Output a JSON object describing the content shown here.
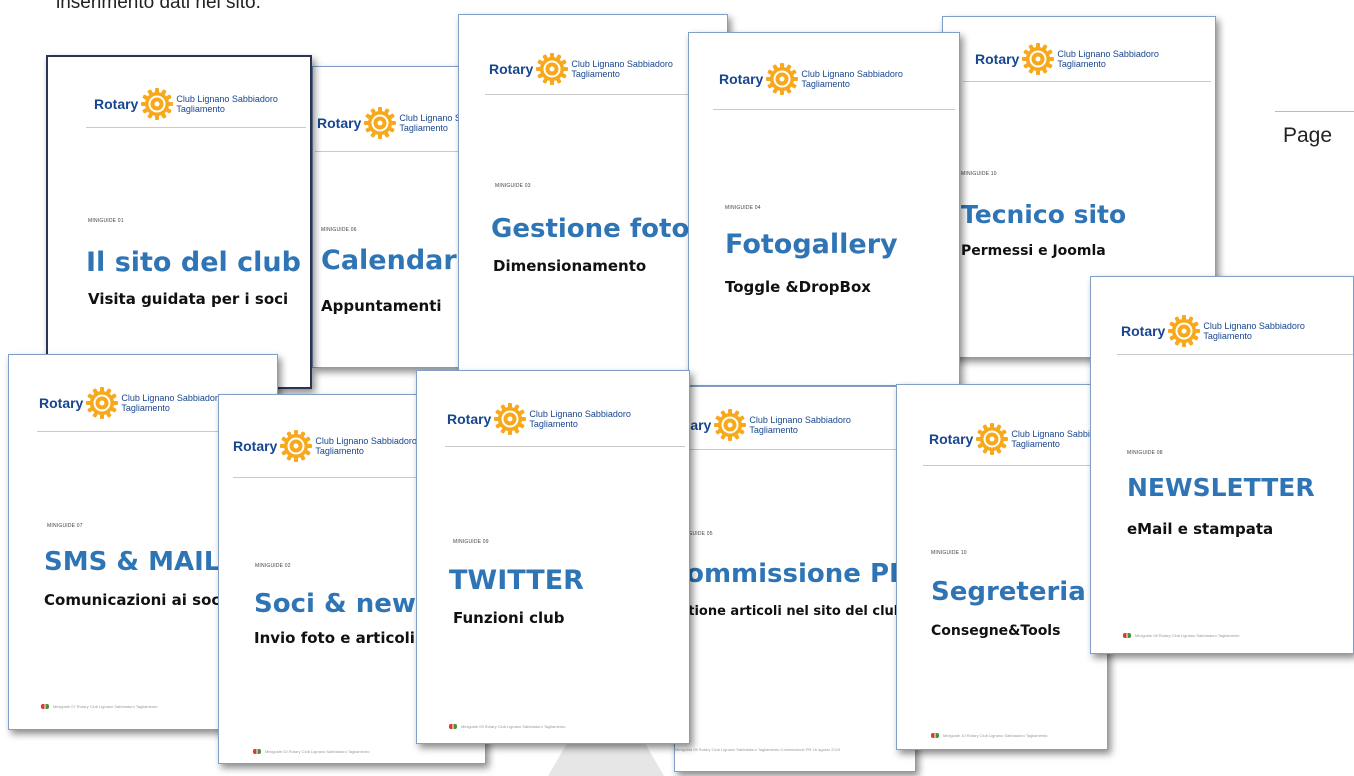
{
  "header_text": "inserimento dati nel sito.",
  "page_label": "Page",
  "brand": {
    "rotary": "Rotary",
    "club_line1": "Club Lignano Sabbiadoro",
    "club_line2": "Tagliamento",
    "blue": "#17458f",
    "gold": "#f7a81b",
    "title_blue": "#2f75b5"
  },
  "cards": [
    {
      "id": "calendar",
      "mini": "MINIGUIDE 06",
      "title": "Calendar",
      "subtitle": "Appuntamenti",
      "footer": ""
    },
    {
      "id": "sito-club",
      "mini": "MINIGUIDE 01",
      "title": "Il sito del club",
      "subtitle": "Visita guidata per i soci",
      "footer": ""
    },
    {
      "id": "gestione-foto",
      "mini": "MINIGUIDE 03",
      "title": "Gestione foto",
      "subtitle": "Dimensionamento",
      "footer": ""
    },
    {
      "id": "fotogallery",
      "mini": "MINIGUIDE 04",
      "title": "Fotogallery",
      "subtitle": "Toggle &DropBox",
      "footer": ""
    },
    {
      "id": "tecnico-sito",
      "mini": "MINIGUIDE 10",
      "title": "Tecnico sito",
      "subtitle": "Permessi e Joomla",
      "footer": ""
    },
    {
      "id": "sms-mails",
      "mini": "MINIGUIDE 07",
      "title": "SMS & MAILS",
      "subtitle": "Comunicazioni ai soci",
      "footer": "Miniguide 07 Rotary Club Lignano Sabbiadoro Tagliamento"
    },
    {
      "id": "soci-news",
      "mini": "MINIGUIDE 02",
      "title": "Soci & news",
      "subtitle": "Invio foto e articoli",
      "footer": "Miniguide 02 Rotary Club Lignano Sabbiadoro Tagliamento"
    },
    {
      "id": "commissione-pr",
      "mini": "MINIGUIDE 05",
      "title": "Commissione PR",
      "subtitle": "Gestione articoli nel sito del club",
      "footer": "Miniguida 05 Rotary Club Lignano Sabbiadoro Tagliamento Commissione PR 16 agosto 2019"
    },
    {
      "id": "twitter",
      "mini": "MINIGUIDE 09",
      "title": "TWITTER",
      "subtitle": "Funzioni club",
      "footer": "Miniguide 09 Rotary Club Lignano Sabbiadoro Tagliamento"
    },
    {
      "id": "segreteria",
      "mini": "MINIGUIDE 10",
      "title": "Segreteria",
      "subtitle": "Consegne&Tools",
      "footer": "Miniguide 10 Rotary Club Lignano Sabbiadoro Tagliamento"
    },
    {
      "id": "newsletter",
      "mini": "MINIGUIDE 08",
      "title": "NEWSLETTER",
      "subtitle": "eMail e stampata",
      "footer": "Miniguide 08 Rotary Club Lignano Sabbiadoro Tagliamento"
    }
  ]
}
